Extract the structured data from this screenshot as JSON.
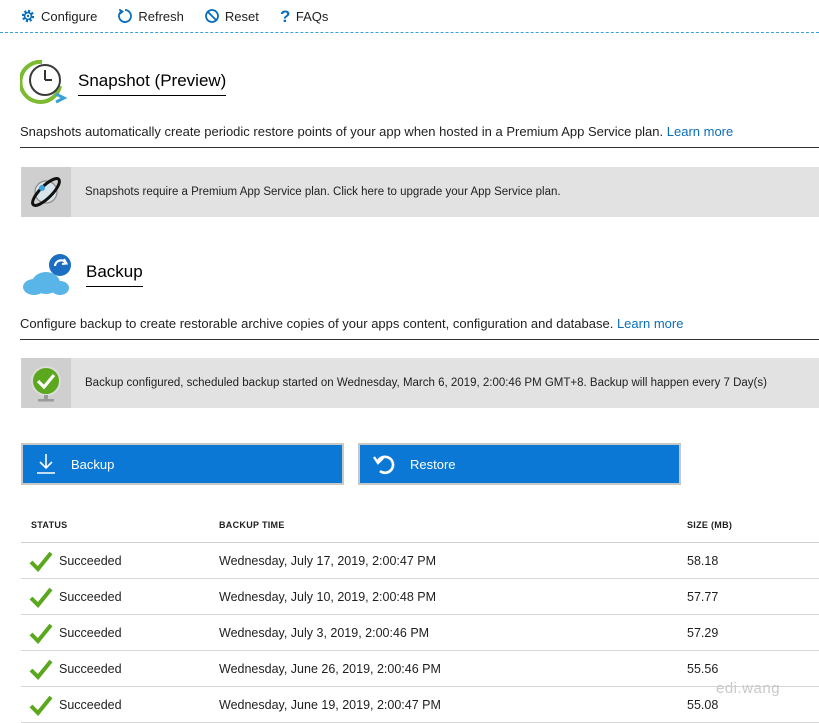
{
  "toolbar": {
    "configure": "Configure",
    "refresh": "Refresh",
    "reset": "Reset",
    "faqs": "FAQs"
  },
  "snapshot": {
    "title": "Snapshot (Preview)",
    "description": "Snapshots automatically create periodic restore points of your app when hosted in a Premium App Service plan.",
    "learn_more": "Learn more",
    "banner": "Snapshots require a Premium App Service plan. Click here to upgrade your App Service plan."
  },
  "backup": {
    "title": "Backup",
    "description": "Configure backup to create restorable archive copies of your apps content, configuration and database.",
    "learn_more": "Learn more",
    "banner": "Backup configured, scheduled backup started on Wednesday, March 6, 2019, 2:00:46 PM GMT+8. Backup will happen every 7 Day(s)"
  },
  "actions": {
    "backup_label": "Backup",
    "restore_label": "Restore"
  },
  "table": {
    "headers": {
      "status": "STATUS",
      "time": "BACKUP TIME",
      "size": "SIZE (MB)"
    },
    "rows": [
      {
        "status": "Succeeded",
        "time": "Wednesday, July 17, 2019, 2:00:47 PM",
        "size": "58.18"
      },
      {
        "status": "Succeeded",
        "time": "Wednesday, July 10, 2019, 2:00:48 PM",
        "size": "57.77"
      },
      {
        "status": "Succeeded",
        "time": "Wednesday, July 3, 2019, 2:00:46 PM",
        "size": "57.29"
      },
      {
        "status": "Succeeded",
        "time": "Wednesday, June 26, 2019, 2:00:46 PM",
        "size": "55.56"
      },
      {
        "status": "Succeeded",
        "time": "Wednesday, June 19, 2019, 2:00:47 PM",
        "size": "55.08"
      }
    ]
  },
  "watermark": "edi.wang",
  "colors": {
    "accent": "#0a78d4",
    "link": "#0a6ebd",
    "success": "#5ba71e",
    "banner_bg": "#e2e2e2"
  }
}
